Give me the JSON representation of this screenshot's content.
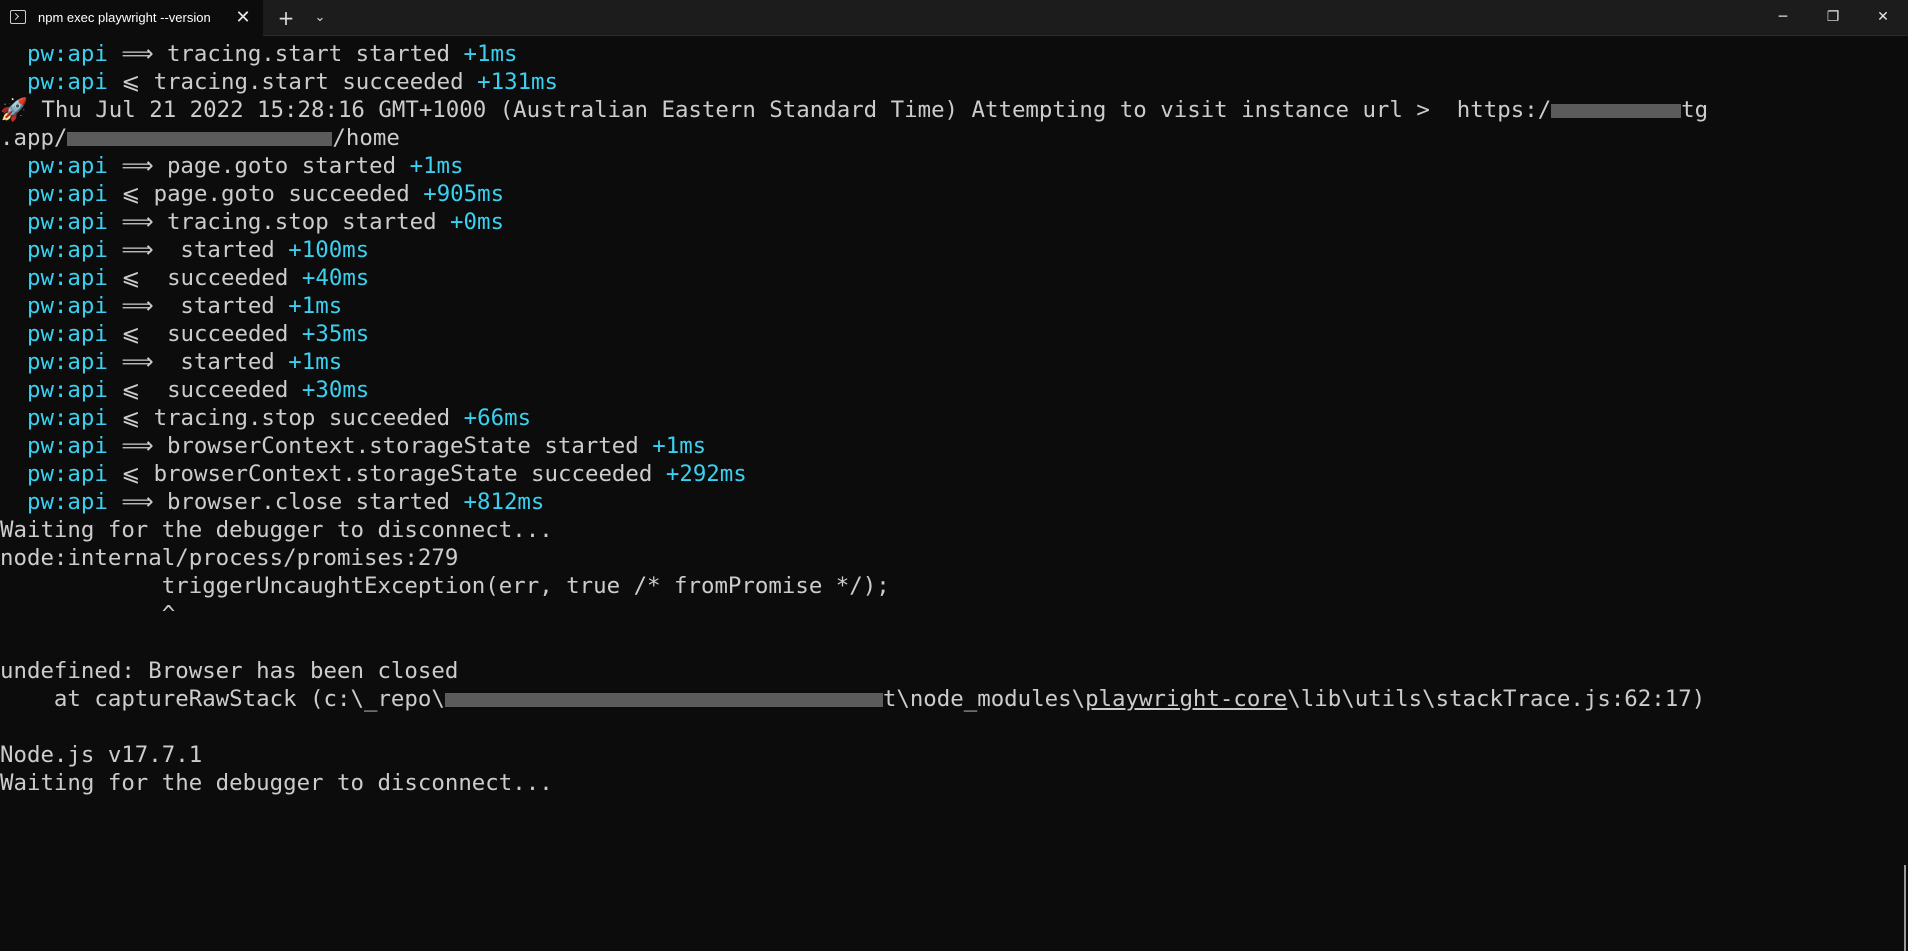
{
  "window": {
    "tab_title": "npm exec playwright --version",
    "tab_close": "✕",
    "new_tab": "+",
    "dropdown": "⌄",
    "minimize": "─",
    "maximize": "❐",
    "close": "✕"
  },
  "colors": {
    "background": "#0c0c0c",
    "text": "#cccccc",
    "accent": "#3ad0f0"
  },
  "terminal": {
    "prefix": "pw:api",
    "arrow_out": "⟹",
    "arrow_in": "⩽",
    "api_lines": [
      {
        "dir": "⟹",
        "text": "tracing.start started",
        "time": "+1ms"
      },
      {
        "dir": "⩽",
        "text": "tracing.start succeeded",
        "time": "+131ms"
      }
    ],
    "rocket_line": {
      "icon": "🚀",
      "text": "Thu Jul 21 2022 15:28:16 GMT+1000 (Australian Eastern Standard Time) Attempting to visit instance url >  https:/",
      "tail": "tg"
    },
    "url_cont": {
      "start": ".app/",
      "end": "/home"
    },
    "api_lines_2": [
      {
        "dir": "⟹",
        "text": "page.goto started",
        "time": "+1ms"
      },
      {
        "dir": "⩽",
        "text": "page.goto succeeded",
        "time": "+905ms"
      },
      {
        "dir": "⟹",
        "text": "tracing.stop started",
        "time": "+0ms"
      },
      {
        "dir": "⟹",
        "text": " started",
        "time": "+100ms"
      },
      {
        "dir": "⩽",
        "text": " succeeded",
        "time": "+40ms"
      },
      {
        "dir": "⟹",
        "text": " started",
        "time": "+1ms"
      },
      {
        "dir": "⩽",
        "text": " succeeded",
        "time": "+35ms"
      },
      {
        "dir": "⟹",
        "text": " started",
        "time": "+1ms"
      },
      {
        "dir": "⩽",
        "text": " succeeded",
        "time": "+30ms"
      },
      {
        "dir": "⩽",
        "text": "tracing.stop succeeded",
        "time": "+66ms"
      },
      {
        "dir": "⟹",
        "text": "browserContext.storageState started",
        "time": "+1ms"
      },
      {
        "dir": "⩽",
        "text": "browserContext.storageState succeeded",
        "time": "+292ms"
      },
      {
        "dir": "⟹",
        "text": "browser.close started",
        "time": "+812ms"
      }
    ],
    "waiting": "Waiting for the debugger to disconnect...",
    "node_internal": "node:internal/process/promises:279",
    "trigger": "            triggerUncaughtException(err, true /* fromPromise */);",
    "caret": "            ^",
    "error": "undefined: Browser has been closed",
    "stack_start": "    at captureRawStack (c:\\_repo\\",
    "stack_mid": "t\\node_modules\\",
    "stack_link": "playwright-core",
    "stack_end": "\\lib\\utils\\stackTrace.js:62:17)",
    "node_version": "Node.js v17.7.1",
    "waiting_2": "Waiting for the debugger to disconnect..."
  }
}
